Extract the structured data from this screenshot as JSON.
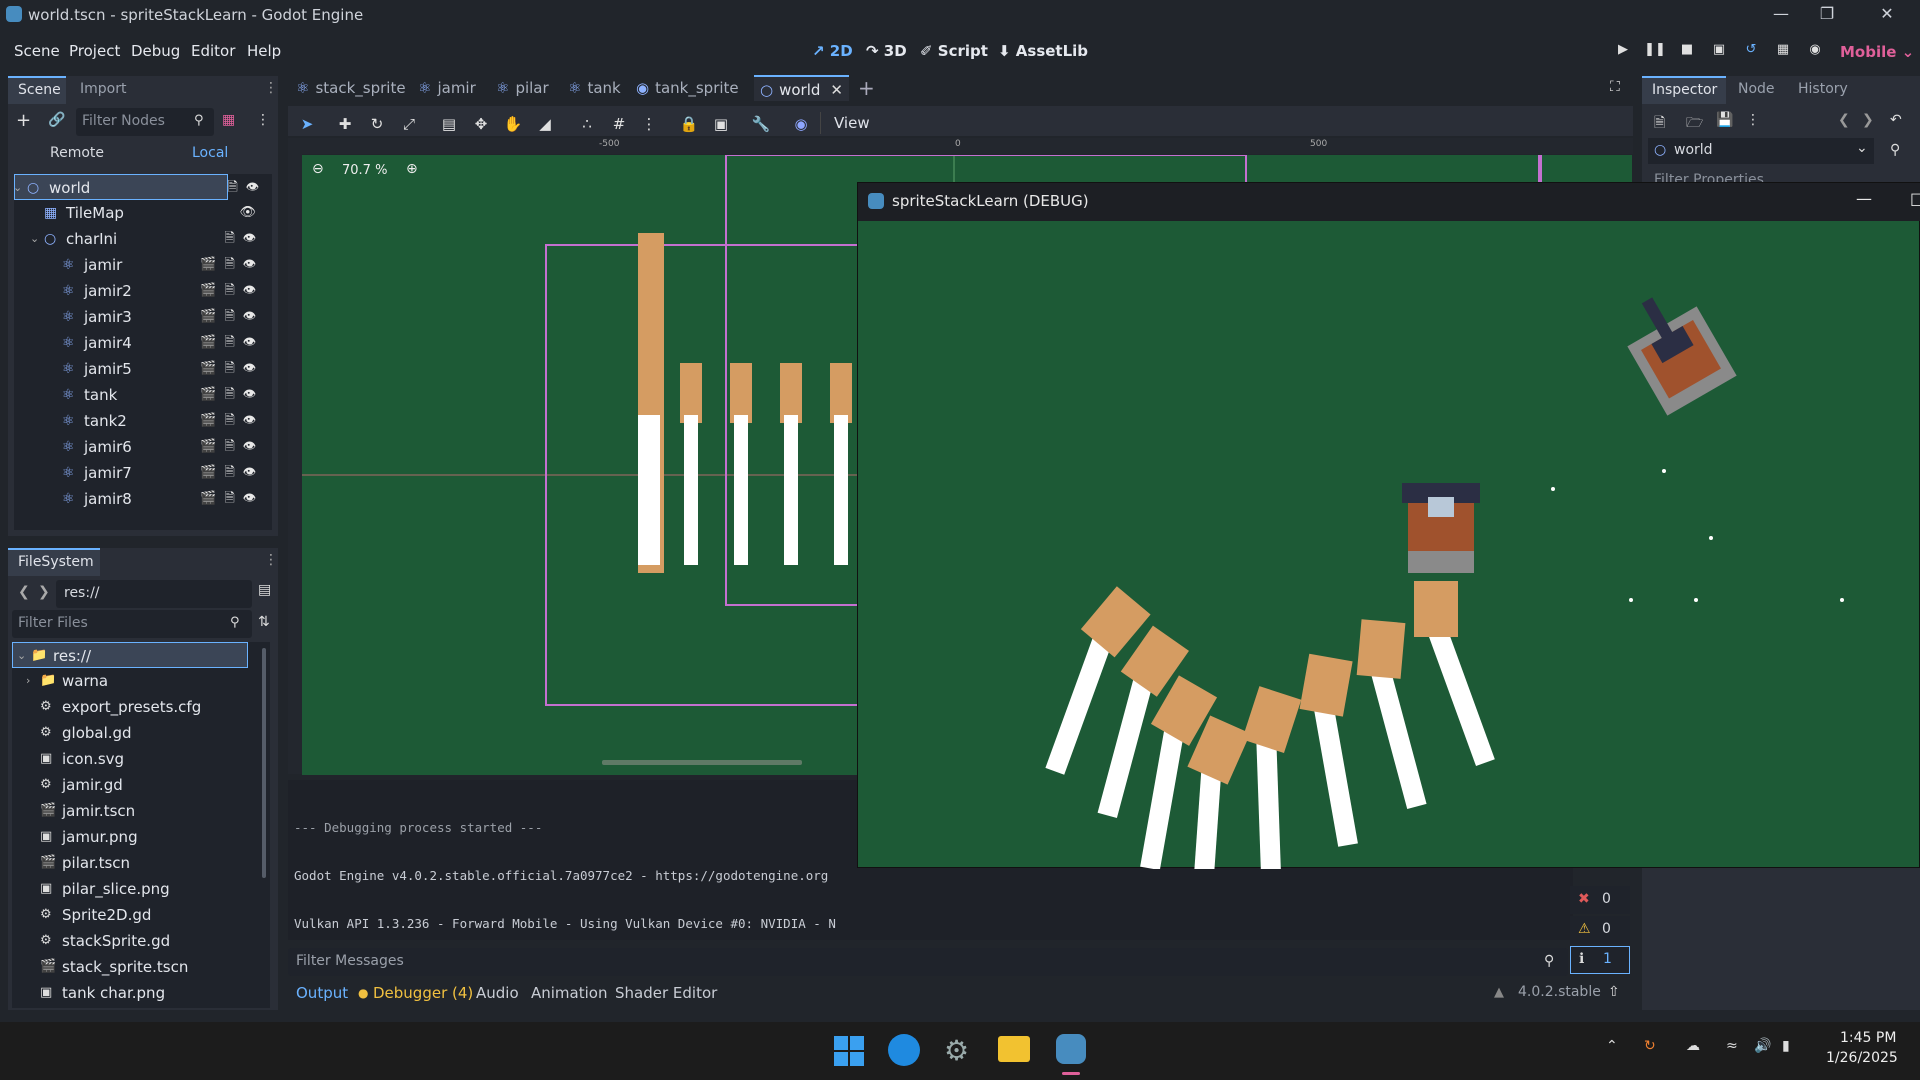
{
  "window": {
    "title": "world.tscn - spriteStackLearn - Godot Engine"
  },
  "menu": [
    "Scene",
    "Project",
    "Debug",
    "Editor",
    "Help"
  ],
  "workspaces": [
    {
      "label": "2D",
      "active": true
    },
    {
      "label": "3D",
      "active": false
    },
    {
      "label": "Script",
      "active": false
    },
    {
      "label": "AssetLib",
      "active": false
    }
  ],
  "renderer": "Mobile",
  "scene_dock": {
    "tabs": [
      "Scene",
      "Import"
    ],
    "filter_placeholder": "Filter Nodes",
    "remote": "Remote",
    "local": "Local",
    "nodes": [
      {
        "name": "world",
        "depth": 0,
        "icon": "node2d"
      },
      {
        "name": "TileMap",
        "depth": 1,
        "icon": "tilemap"
      },
      {
        "name": "charIni",
        "depth": 1,
        "icon": "node2d"
      },
      {
        "name": "jamir",
        "depth": 2,
        "icon": "character"
      },
      {
        "name": "jamir2",
        "depth": 2,
        "icon": "character"
      },
      {
        "name": "jamir3",
        "depth": 2,
        "icon": "character"
      },
      {
        "name": "jamir4",
        "depth": 2,
        "icon": "character"
      },
      {
        "name": "jamir5",
        "depth": 2,
        "icon": "character"
      },
      {
        "name": "tank",
        "depth": 2,
        "icon": "character"
      },
      {
        "name": "tank2",
        "depth": 2,
        "icon": "character"
      },
      {
        "name": "jamir6",
        "depth": 2,
        "icon": "character"
      },
      {
        "name": "jamir7",
        "depth": 2,
        "icon": "character"
      },
      {
        "name": "jamir8",
        "depth": 2,
        "icon": "character"
      }
    ]
  },
  "filesystem": {
    "title": "FileSystem",
    "path": "res://",
    "filter_placeholder": "Filter Files",
    "items": [
      {
        "name": "res://",
        "type": "folder"
      },
      {
        "name": "warna",
        "type": "folder"
      },
      {
        "name": "export_presets.cfg",
        "type": "cfg"
      },
      {
        "name": "global.gd",
        "type": "script"
      },
      {
        "name": "icon.svg",
        "type": "image"
      },
      {
        "name": "jamir.gd",
        "type": "script"
      },
      {
        "name": "jamir.tscn",
        "type": "scene"
      },
      {
        "name": "jamur.png",
        "type": "image"
      },
      {
        "name": "pilar.tscn",
        "type": "scene"
      },
      {
        "name": "pilar_slice.png",
        "type": "image"
      },
      {
        "name": "Sprite2D.gd",
        "type": "script"
      },
      {
        "name": "stackSprite.gd",
        "type": "script"
      },
      {
        "name": "stack_sprite.tscn",
        "type": "scene"
      },
      {
        "name": "tank char.png",
        "type": "image"
      }
    ]
  },
  "editor_tabs": [
    "stack_sprite",
    "jamir",
    "pilar",
    "tank",
    "tank_sprite",
    "world"
  ],
  "toolbar": {
    "view": "View"
  },
  "canvas": {
    "zoom": "70.7 %",
    "ruler": [
      "-500",
      "0",
      "500"
    ]
  },
  "console": {
    "lines": [
      "--- Debugging process started ---",
      "Godot Engine v4.0.2.stable.official.7a0977ce2 - https://godotengine.org",
      "Vulkan API 1.3.236 - Forward Mobile - Using Vulkan Device #0: NVIDIA - N"
    ],
    "filter_placeholder": "Filter Messages",
    "errors": "0",
    "warnings": "0",
    "messages": "1"
  },
  "bottom_tabs": [
    "Output",
    "Debugger (4)",
    "Audio",
    "Animation",
    "Shader Editor"
  ],
  "version": "4.0.2.stable",
  "inspector": {
    "tabs": [
      "Inspector",
      "Node",
      "History"
    ],
    "object": "world",
    "filter_placeholder": "Filter Properties"
  },
  "debug_window": {
    "title": "spriteStackLearn (DEBUG)"
  },
  "taskbar": {
    "time": "1:45 PM",
    "date": "1/26/2025"
  }
}
